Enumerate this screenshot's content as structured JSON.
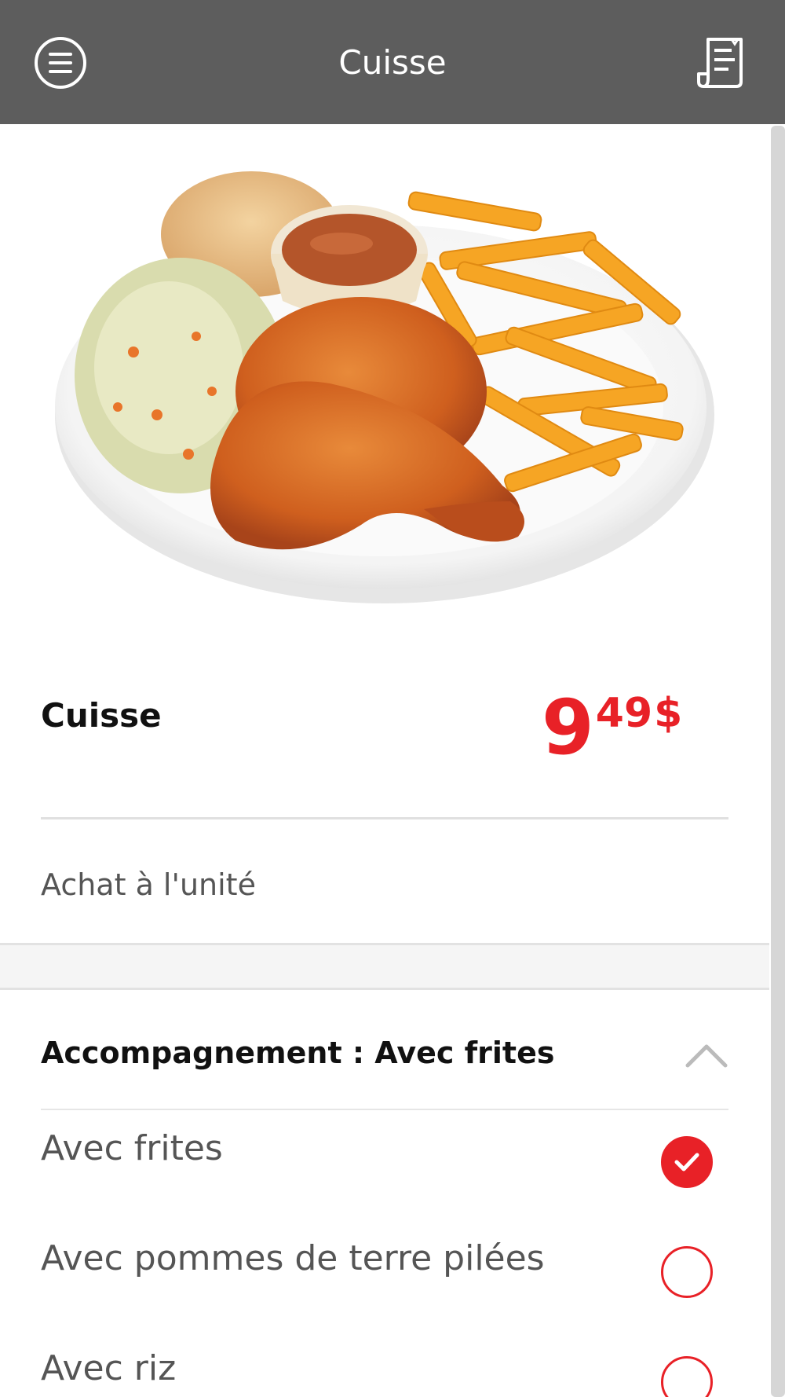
{
  "header": {
    "title": "Cuisse",
    "menu_icon": "menu-icon",
    "receipt_icon": "receipt-icon"
  },
  "product": {
    "name": "Cuisse",
    "price_main": "9",
    "price_cents": "49",
    "price_currency": "$",
    "unit_label": "Achat à l'unité",
    "image": "chicken-leg-plate-image"
  },
  "accompaniment": {
    "header": "Accompagnement : Avec frites",
    "options": [
      {
        "label": "Avec frites",
        "checked": true
      },
      {
        "label": "Avec pommes de terre pilées",
        "checked": false
      },
      {
        "label": "Avec riz",
        "checked": false
      }
    ]
  },
  "colors": {
    "header_bg": "#5d5d5d",
    "accent": "#e82127"
  }
}
